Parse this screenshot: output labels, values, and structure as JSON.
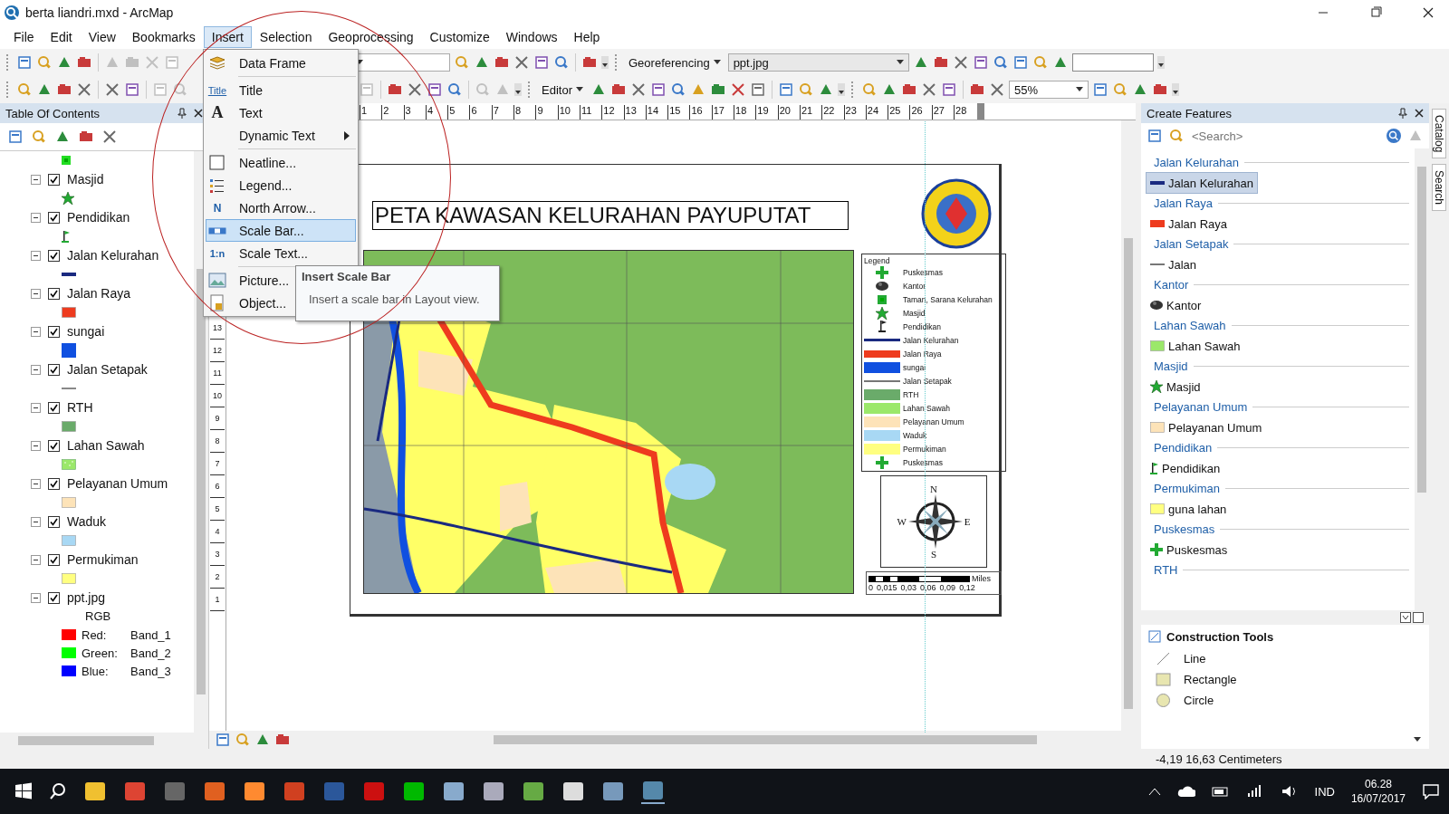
{
  "window": {
    "title": "berta liandri.mxd - ArcMap"
  },
  "menu_bar": [
    {
      "label": "File",
      "selected": false
    },
    {
      "label": "Edit",
      "selected": false
    },
    {
      "label": "View",
      "selected": false
    },
    {
      "label": "Bookmarks",
      "selected": false
    },
    {
      "label": "Insert",
      "selected": true
    },
    {
      "label": "Selection",
      "selected": false
    },
    {
      "label": "Geoprocessing",
      "selected": false
    },
    {
      "label": "Customize",
      "selected": false
    },
    {
      "label": "Windows",
      "selected": false
    },
    {
      "label": "Help",
      "selected": false
    }
  ],
  "insert_menu": [
    {
      "label": "Data Frame",
      "kind": "frame",
      "selected": false,
      "submenu": false,
      "separator_after": true
    },
    {
      "label": "Title",
      "kind": "title",
      "icon_text": "Title",
      "selected": false,
      "submenu": false,
      "separator_after": false
    },
    {
      "label": "Text",
      "kind": "text",
      "icon_text": "A",
      "selected": false,
      "submenu": false,
      "separator_after": false
    },
    {
      "label": "Dynamic Text",
      "kind": "none",
      "selected": false,
      "submenu": true,
      "separator_after": true
    },
    {
      "label": "Neatline...",
      "kind": "neatline",
      "selected": false,
      "submenu": false,
      "separator_after": false
    },
    {
      "label": "Legend...",
      "kind": "legend",
      "selected": false,
      "submenu": false,
      "separator_after": false
    },
    {
      "label": "North Arrow...",
      "kind": "north",
      "icon_text": "N",
      "selected": false,
      "submenu": false,
      "separator_after": false
    },
    {
      "label": "Scale Bar...",
      "kind": "scalebar",
      "selected": true,
      "submenu": false,
      "separator_after": false
    },
    {
      "label": "Scale Text...",
      "kind": "scaletext",
      "icon_text": "1:n",
      "selected": false,
      "submenu": false,
      "separator_after": true
    },
    {
      "label": "Picture...",
      "kind": "picture",
      "selected": false,
      "submenu": false,
      "separator_after": false
    },
    {
      "label": "Object...",
      "kind": "object",
      "selected": false,
      "submenu": false,
      "separator_after": false
    }
  ],
  "tooltip": {
    "title": "Insert Scale Bar",
    "text": "Insert a scale bar in Layout view."
  },
  "toolbars": {
    "georeferencing": "Georeferencing",
    "layer_dropdown": "ppt.jpg",
    "editor": "Editor",
    "zoom_dropdown": "55%"
  },
  "toc": {
    "title": "Table Of Contents",
    "layers": [
      {
        "name": "Masjid",
        "checked": true,
        "expanded": true,
        "kind": "star",
        "color": "#22aa33"
      },
      {
        "name": "Pendidikan",
        "checked": true,
        "expanded": true,
        "kind": "flag",
        "color": "#22aa33"
      },
      {
        "name": "Jalan Kelurahan",
        "checked": true,
        "expanded": true,
        "kind": "line",
        "color": "#1a2a80"
      },
      {
        "name": "Jalan Raya",
        "checked": true,
        "expanded": true,
        "kind": "fill",
        "color": "#ee3b1e"
      },
      {
        "name": "sungai",
        "checked": true,
        "expanded": true,
        "kind": "tall",
        "color": "#1050e0"
      },
      {
        "name": "Jalan Setapak",
        "checked": true,
        "expanded": true,
        "kind": "thin",
        "color": "#888888"
      },
      {
        "name": "RTH",
        "checked": true,
        "expanded": true,
        "kind": "fill",
        "color": "#6aab6a"
      },
      {
        "name": "Lahan Sawah",
        "checked": true,
        "expanded": true,
        "kind": "dots",
        "color": "#9be86a"
      },
      {
        "name": "Pelayanan Umum",
        "checked": true,
        "expanded": true,
        "kind": "fill",
        "color": "#fde3b8"
      },
      {
        "name": "Waduk",
        "checked": true,
        "expanded": true,
        "kind": "fill",
        "color": "#a8d8f4"
      },
      {
        "name": "Permukiman",
        "checked": true,
        "expanded": true,
        "kind": "fill",
        "color": "#ffff80"
      },
      {
        "name": "ppt.jpg",
        "checked": true,
        "expanded": true,
        "kind": "raster",
        "rgb_label": "RGB",
        "bands": [
          {
            "label": "Red:",
            "band": "Band_1",
            "color": "#ff0000"
          },
          {
            "label": "Green:",
            "band": "Band_2",
            "color": "#00ff00"
          },
          {
            "label": "Blue:",
            "band": "Band_3",
            "color": "#0000ff"
          }
        ]
      }
    ]
  },
  "layout": {
    "ruler_h": [
      "1",
      "2",
      "3",
      "4",
      "5",
      "6",
      "7",
      "8",
      "9",
      "10",
      "11",
      "12",
      "13",
      "14",
      "15",
      "16",
      "17",
      "18",
      "19",
      "20",
      "21",
      "22",
      "23",
      "24",
      "25",
      "26",
      "27",
      "28"
    ],
    "ruler_v": [
      "13",
      "12",
      "11",
      "10",
      "9",
      "8",
      "7",
      "6",
      "5",
      "4",
      "3",
      "2",
      "1"
    ],
    "map_title": "PETA KAWASAN KELURAHAN PAYUPUTAT",
    "legend_title": "Legend",
    "legend": [
      {
        "label": "Puskesmas",
        "kind": "cross",
        "color": "#22aa33"
      },
      {
        "label": "Kantor",
        "kind": "blob",
        "color": "#333333"
      },
      {
        "label": "Taman, Sarana Kelurahan",
        "kind": "square",
        "color": "#22aa33"
      },
      {
        "label": "Masjid",
        "kind": "star",
        "color": "#22aa33"
      },
      {
        "label": "Pendidikan",
        "kind": "flag",
        "color": "#222222"
      },
      {
        "label": "Jalan Kelurahan",
        "kind": "line",
        "color": "#1a2a80"
      },
      {
        "label": "Jalan Raya",
        "kind": "band",
        "color": "#ee3b1e"
      },
      {
        "label": "sungai",
        "kind": "fill",
        "color": "#1050e0"
      },
      {
        "label": "Jalan Setapak",
        "kind": "thin",
        "color": "#777777"
      },
      {
        "label": "RTH",
        "kind": "fill",
        "color": "#6aab6a"
      },
      {
        "label": "Lahan Sawah",
        "kind": "fill",
        "color": "#9be86a"
      },
      {
        "label": "Pelayanan Umum",
        "kind": "fill",
        "color": "#fde3b8"
      },
      {
        "label": "Waduk",
        "kind": "fill",
        "color": "#a8d8f4"
      },
      {
        "label": "Permukiman",
        "kind": "fill",
        "color": "#ffff80"
      },
      {
        "label": "Puskesmas",
        "kind": "cross",
        "color": "#22aa33"
      }
    ],
    "compass": {
      "north": "N",
      "east": "E",
      "south": "S",
      "west": "W"
    },
    "scale_labels": [
      "0",
      "0,015",
      "0,03",
      "0,06",
      "0,09",
      "0,12"
    ],
    "scale_unit": "Miles"
  },
  "create_features": {
    "title": "Create Features",
    "search_placeholder": "<Search>",
    "groups": [
      {
        "heading": "Jalan Kelurahan",
        "template": "Jalan Kelurahan",
        "kind": "line",
        "color": "#1a2a80",
        "selected": true
      },
      {
        "heading": "Jalan Raya",
        "template": "Jalan Raya",
        "kind": "band",
        "color": "#ee3b1e",
        "selected": false
      },
      {
        "heading": "Jalan Setapak",
        "template": "Jalan",
        "kind": "thin",
        "color": "#777777",
        "selected": false
      },
      {
        "heading": "Kantor",
        "template": "Kantor",
        "kind": "blob",
        "color": "#333333",
        "selected": false
      },
      {
        "heading": "Lahan Sawah",
        "template": "Lahan Sawah",
        "kind": "fill",
        "color": "#9be86a",
        "selected": false
      },
      {
        "heading": "Masjid",
        "template": "Masjid",
        "kind": "star",
        "color": "#22aa33",
        "selected": false
      },
      {
        "heading": "Pelayanan Umum",
        "template": "Pelayanan Umum",
        "kind": "fill",
        "color": "#fde3b8",
        "selected": false
      },
      {
        "heading": "Pendidikan",
        "template": "Pendidikan",
        "kind": "flag",
        "color": "#22aa33",
        "selected": false
      },
      {
        "heading": "Permukiman",
        "template": "guna lahan",
        "kind": "fill",
        "color": "#ffff80",
        "selected": false
      },
      {
        "heading": "Puskesmas",
        "template": "Puskesmas",
        "kind": "cross",
        "color": "#22aa33",
        "selected": false
      },
      {
        "heading": "RTH"
      }
    ]
  },
  "construction_tools": {
    "title": "Construction Tools",
    "tools": [
      {
        "label": "Line",
        "kind": "line"
      },
      {
        "label": "Rectangle",
        "kind": "rect"
      },
      {
        "label": "Circle",
        "kind": "circle"
      }
    ]
  },
  "side_tabs": [
    "Catalog",
    "Search"
  ],
  "status_bar": {
    "coords": "-4,19 16,63 Centimeters"
  },
  "taskbar": {
    "language": "IND",
    "time": "06.28",
    "date": "16/07/2017"
  }
}
